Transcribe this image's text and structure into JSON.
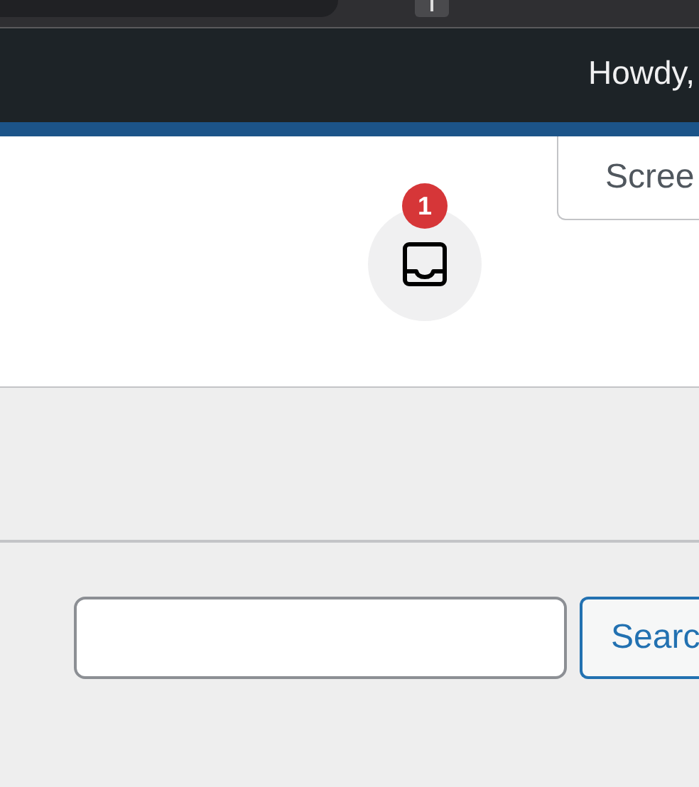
{
  "admin_bar": {
    "greeting": "Howdy,"
  },
  "screen_options": {
    "label": "Scree"
  },
  "inbox": {
    "badge": "1"
  },
  "search": {
    "button": "Searc"
  }
}
